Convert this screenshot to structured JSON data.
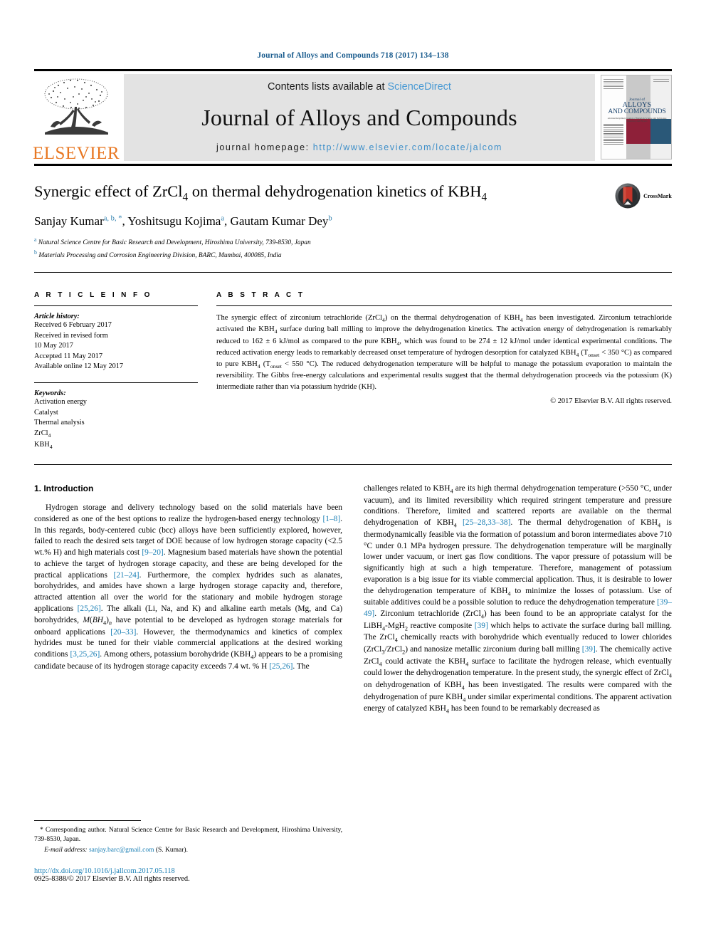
{
  "running_head": "Journal of Alloys and Compounds 718 (2017) 134–138",
  "masthead": {
    "contents_prefix": "Contents lists available at ",
    "sciencedirect": "ScienceDirect",
    "journal_name": "Journal of Alloys and Compounds",
    "homepage_prefix": "journal homepage:",
    "homepage_url": "http://www.elsevier.com/locate/jalcom",
    "publisher": "ELSEVIER",
    "publisher_color": "#E87722",
    "link_color": "#3e8fc9",
    "cover": {
      "line1": "Journal of",
      "line2": "ALLOYS",
      "line3": "AND COMPOUNDS",
      "subline": "An Interdisciplinary Journal of Materials Science and Solid-state Chemistry and Physics",
      "red_color": "#8e2039",
      "blue_color": "#2a5878"
    }
  },
  "article": {
    "title_part1": "Synergic effect of ZrCl",
    "title_sub1": "4",
    "title_part2": " on thermal dehydrogenation kinetics of KBH",
    "title_sub2": "4",
    "crossmark_label": "CrossMark",
    "authors": [
      {
        "name": "Sanjay Kumar",
        "marks": "a, b, *"
      },
      {
        "name": "Yoshitsugu Kojima",
        "marks": "a"
      },
      {
        "name": "Gautam Kumar Dey",
        "marks": "b"
      }
    ],
    "affiliations": [
      {
        "mark": "a",
        "text": "Natural Science Centre for Basic Research and Development, Hiroshima University, 739-8530, Japan"
      },
      {
        "mark": "b",
        "text": "Materials Processing and Corrosion Engineering Division, BARC, Mumbai, 400085, India"
      }
    ]
  },
  "article_info": {
    "heading": "A R T I C L E   I N F O",
    "history_label": "Article history:",
    "history": [
      "Received 6 February 2017",
      "Received in revised form",
      "10 May 2017",
      "Accepted 11 May 2017",
      "Available online 12 May 2017"
    ],
    "keywords_label": "Keywords:",
    "keywords": [
      "Activation energy",
      "Catalyst",
      "Thermal analysis",
      "ZrCl4",
      "KBH4"
    ]
  },
  "abstract": {
    "heading": "A B S T R A C T",
    "text": "The synergic effect of zirconium tetrachloride (ZrCl4) on the thermal dehydrogenation of KBH4 has been investigated. Zirconium tetrachloride activated the KBH4 surface during ball milling to improve the dehydrogenation kinetics. The activation energy of dehydrogenation is remarkably reduced to 162 ± 6 kJ/mol as compared to the pure KBH4, which was found to be 274 ± 12 kJ/mol under identical experimental conditions. The reduced activation energy leads to remarkably decreased onset temperature of hydrogen desorption for catalyzed KBH4 (Tonset < 350 °C) as compared to pure KBH4 (Tonset < 550 °C). The reduced dehydrogenation temperature will be helpful to manage the potassium evaporation to maintain the reversibility. The Gibbs free-energy calculations and experimental results suggest that the thermal dehydrogenation proceeds via the potassium (K) intermediate rather than via potassium hydride (KH).",
    "copyright": "© 2017 Elsevier B.V. All rights reserved."
  },
  "introduction": {
    "heading": "1.  Introduction",
    "left_paragraph": "Hydrogen storage and delivery technology based on the solid materials have been considered as one of the best options to realize the hydrogen-based energy technology [1–8]. In this regards, body-centered cubic (bcc) alloys have been sufficiently explored, however, failed to reach the desired sets target of DOE because of low hydrogen storage capacity (<2.5 wt.% H) and high materials cost [9–20]. Magnesium based materials have shown the potential to achieve the target of hydrogen storage capacity, and these are being developed for the practical applications [21–24]. Furthermore, the complex hydrides such as alanates, borohydrides, and amides have shown a large hydrogen storage capacity and, therefore, attracted attention all over the world for the stationary and mobile hydrogen storage applications [25,26]. The alkali (Li, Na, and K) and alkaline earth metals (Mg, and Ca) borohydrides, M(BH4)n have potential to be developed as hydrogen storage materials for onboard applications [20–33]. However, the thermodynamics and kinetics of complex hydrides must be tuned for their viable commercial applications at the desired working conditions [3,25,26]. Among others, potassium borohydride (KBH4) appears to be a promising candidate because of its hydrogen storage capacity exceeds 7.4 wt. % H [25,26]. The",
    "right_paragraph": "challenges related to KBH4 are its high thermal dehydrogenation temperature (>550 °C, under vacuum), and its limited reversibility which required stringent temperature and pressure conditions. Therefore, limited and scattered reports are available on the thermal dehydrogenation of KBH4 [25–28,33–38]. The thermal dehydrogenation of KBH4 is thermodynamically feasible via the formation of potassium and boron intermediates above 710 °C under 0.1 MPa hydrogen pressure. The dehydrogenation temperature will be marginally lower under vacuum, or inert gas flow conditions. The vapor pressure of potassium will be significantly high at such a high temperature. Therefore, management of potassium evaporation is a big issue for its viable commercial application. Thus, it is desirable to lower the dehydrogenation temperature of KBH4 to minimize the losses of potassium. Use of suitable additives could be a possible solution to reduce the dehydrogenation temperature [39–49]. Zirconium tetrachloride (ZrCl4) has been found to be an appropriate catalyst for the LiBH4-MgH2 reactive composite [39] which helps to activate the surface during ball milling. The ZrCl4 chemically reacts with borohydride which eventually reduced to lower chlorides (ZrCl3/ZrCl2) and nanosize metallic zirconium during ball milling [39]. The chemically active ZrCl4 could activate the KBH4 surface to facilitate the hydrogen release, which eventually could lower the dehydrogenation temperature. In the present study, the synergic effect of ZrCl4 on dehydrogenation of KBH4 has been investigated. The results were compared with the dehydrogenation of pure KBH4 under similar experimental conditions. The apparent activation energy of catalyzed KBH4 has been found to be remarkably decreased as"
  },
  "footnote": {
    "corresponding": "* Corresponding author. Natural Science Centre for Basic Research and Development, Hiroshima University, 739-8530, Japan.",
    "email_label": "E-mail address:",
    "email": "sanjay.barc@gmail.com",
    "email_suffix": "(S. Kumar).",
    "doi": "http://dx.doi.org/10.1016/j.jallcom.2017.05.118",
    "issn": "0925-8388/© 2017 Elsevier B.V. All rights reserved."
  }
}
